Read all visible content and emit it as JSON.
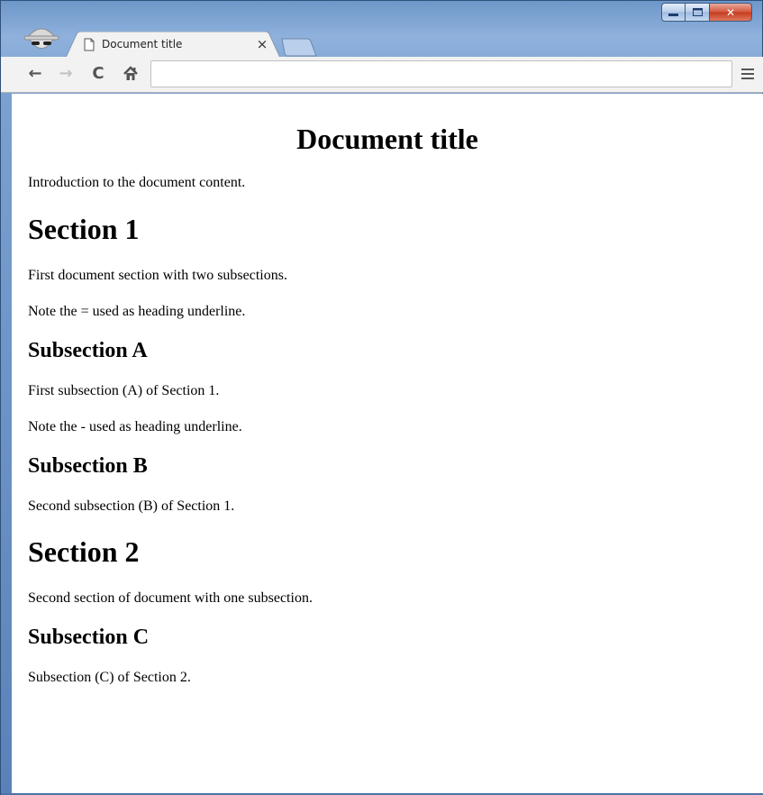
{
  "browser": {
    "tab": {
      "title": "Document title",
      "close_glyph": "×",
      "favicon": "page-icon"
    },
    "window_controls": {
      "minimize": "minimize-icon",
      "maximize": "maximize-icon",
      "close": "✕"
    },
    "toolbar": {
      "back": "←",
      "forward": "→",
      "reload": "C",
      "home": "home-icon",
      "omnibox_value": "",
      "menu": "menu-icon"
    },
    "colors": {
      "frame": "#7aa1d1",
      "close_button": "#c43b1f",
      "toolbar": "#f2f2f2"
    }
  },
  "document": {
    "title": "Document title",
    "intro": "Introduction to the document content.",
    "section1": {
      "heading": "Section 1",
      "text1": "First document section with two subsections.",
      "text2": "Note the = used as heading underline.",
      "subA": {
        "heading": "Subsection A",
        "text1": "First subsection (A) of Section 1.",
        "text2": "Note the - used as heading underline."
      },
      "subB": {
        "heading": "Subsection B",
        "text1": "Second subsection (B) of Section 1."
      }
    },
    "section2": {
      "heading": "Section 2",
      "text1": "Second section of document with one subsection.",
      "subC": {
        "heading": "Subsection C",
        "text1": "Subsection (C) of Section 2."
      }
    }
  }
}
